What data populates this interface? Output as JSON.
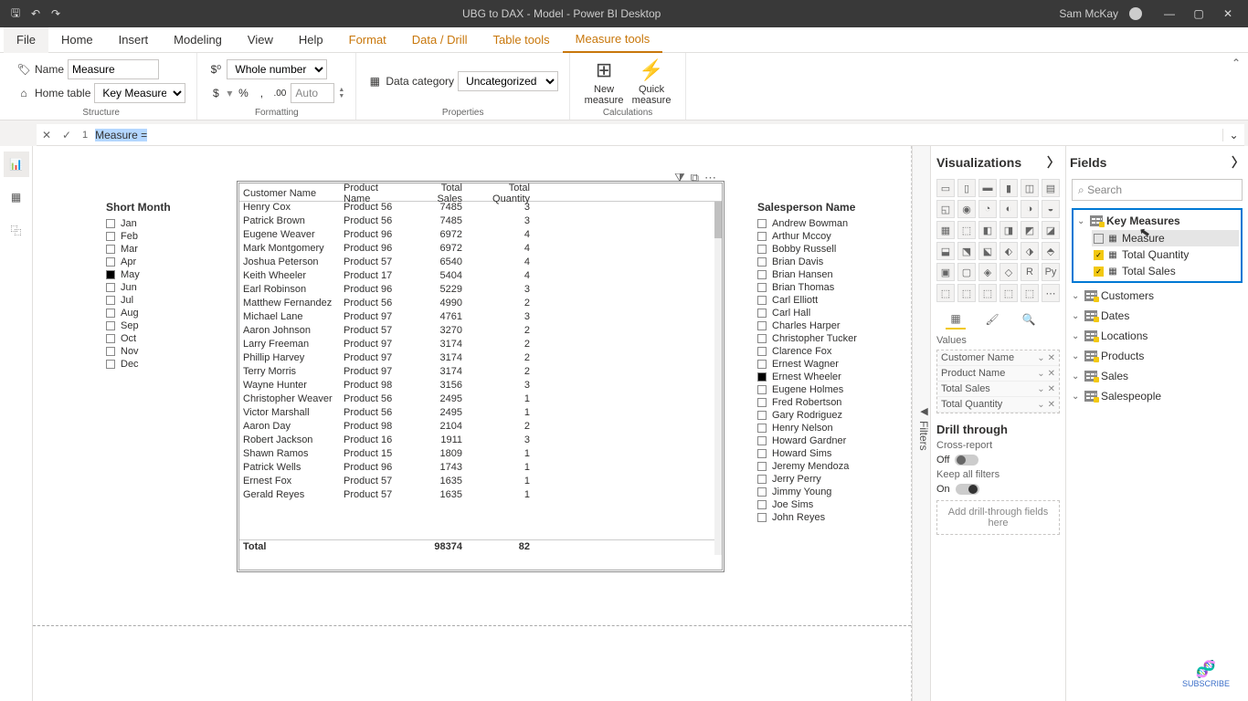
{
  "titlebar": {
    "title": "UBG to DAX - Model - Power BI Desktop",
    "user": "Sam McKay"
  },
  "tabs": {
    "file": "File",
    "home": "Home",
    "insert": "Insert",
    "modeling": "Modeling",
    "view": "View",
    "help": "Help",
    "format": "Format",
    "datadrill": "Data / Drill",
    "tabletools": "Table tools",
    "measuretools": "Measure tools"
  },
  "ribbon": {
    "name_label": "Name",
    "name_value": "Measure",
    "hometable_label": "Home table",
    "hometable_value": "Key Measures",
    "format_value": "Whole number",
    "auto_label": "Auto",
    "datacat_label": "Data category",
    "datacat_value": "Uncategorized",
    "newmeasure": "New measure",
    "quickmeasure": "Quick measure",
    "g_structure": "Structure",
    "g_formatting": "Formatting",
    "g_properties": "Properties",
    "g_calculations": "Calculations"
  },
  "formula": {
    "line": "1",
    "text_sel": "Measure =",
    "text_rest": ""
  },
  "slicer_month": {
    "title": "Short Month",
    "items": [
      "Jan",
      "Feb",
      "Mar",
      "Apr",
      "May",
      "Jun",
      "Jul",
      "Aug",
      "Sep",
      "Oct",
      "Nov",
      "Dec"
    ],
    "selected": "May"
  },
  "table": {
    "headers": {
      "c1": "Customer Name",
      "c2": "Product Name",
      "c3": "Total Sales",
      "c4": "Total Quantity"
    },
    "rows": [
      {
        "c": "Henry Cox",
        "p": "Product 56",
        "s": "7485",
        "q": "3"
      },
      {
        "c": "Patrick Brown",
        "p": "Product 56",
        "s": "7485",
        "q": "3"
      },
      {
        "c": "Eugene Weaver",
        "p": "Product 96",
        "s": "6972",
        "q": "4"
      },
      {
        "c": "Mark Montgomery",
        "p": "Product 96",
        "s": "6972",
        "q": "4"
      },
      {
        "c": "Joshua Peterson",
        "p": "Product 57",
        "s": "6540",
        "q": "4"
      },
      {
        "c": "Keith Wheeler",
        "p": "Product 17",
        "s": "5404",
        "q": "4"
      },
      {
        "c": "Earl Robinson",
        "p": "Product 96",
        "s": "5229",
        "q": "3"
      },
      {
        "c": "Matthew Fernandez",
        "p": "Product 56",
        "s": "4990",
        "q": "2"
      },
      {
        "c": "Michael Lane",
        "p": "Product 97",
        "s": "4761",
        "q": "3"
      },
      {
        "c": "Aaron Johnson",
        "p": "Product 57",
        "s": "3270",
        "q": "2"
      },
      {
        "c": "Larry Freeman",
        "p": "Product 97",
        "s": "3174",
        "q": "2"
      },
      {
        "c": "Phillip Harvey",
        "p": "Product 97",
        "s": "3174",
        "q": "2"
      },
      {
        "c": "Terry Morris",
        "p": "Product 97",
        "s": "3174",
        "q": "2"
      },
      {
        "c": "Wayne Hunter",
        "p": "Product 98",
        "s": "3156",
        "q": "3"
      },
      {
        "c": "Christopher Weaver",
        "p": "Product 56",
        "s": "2495",
        "q": "1"
      },
      {
        "c": "Victor Marshall",
        "p": "Product 56",
        "s": "2495",
        "q": "1"
      },
      {
        "c": "Aaron Day",
        "p": "Product 98",
        "s": "2104",
        "q": "2"
      },
      {
        "c": "Robert Jackson",
        "p": "Product 16",
        "s": "1911",
        "q": "3"
      },
      {
        "c": "Shawn Ramos",
        "p": "Product 15",
        "s": "1809",
        "q": "1"
      },
      {
        "c": "Patrick Wells",
        "p": "Product 96",
        "s": "1743",
        "q": "1"
      },
      {
        "c": "Ernest Fox",
        "p": "Product 57",
        "s": "1635",
        "q": "1"
      },
      {
        "c": "Gerald Reyes",
        "p": "Product 57",
        "s": "1635",
        "q": "1"
      }
    ],
    "footer": {
      "label": "Total",
      "s": "98374",
      "q": "82"
    }
  },
  "slicer_sales": {
    "title": "Salesperson Name",
    "items": [
      "Andrew Bowman",
      "Arthur Mccoy",
      "Bobby Russell",
      "Brian Davis",
      "Brian Hansen",
      "Brian Thomas",
      "Carl Elliott",
      "Carl Hall",
      "Charles Harper",
      "Christopher Tucker",
      "Clarence Fox",
      "Ernest Wagner",
      "Ernest Wheeler",
      "Eugene Holmes",
      "Fred Robertson",
      "Gary Rodriguez",
      "Henry Nelson",
      "Howard Gardner",
      "Howard Sims",
      "Jeremy Mendoza",
      "Jerry Perry",
      "Jimmy Young",
      "Joe Sims",
      "John Reyes"
    ],
    "selected": "Ernest Wheeler"
  },
  "filters_label": "Filters",
  "viz": {
    "header": "Visualizations",
    "values_label": "Values",
    "wells": [
      "Customer Name",
      "Product Name",
      "Total Sales",
      "Total Quantity"
    ],
    "drill_header": "Drill through",
    "cross_label": "Cross-report",
    "off": "Off",
    "keep_label": "Keep all filters",
    "on": "On",
    "drop_hint": "Add drill-through fields here"
  },
  "fields": {
    "header": "Fields",
    "search": "Search",
    "key_measures": "Key Measures",
    "km_items": [
      {
        "label": "Measure",
        "checked": false
      },
      {
        "label": "Total Quantity",
        "checked": true
      },
      {
        "label": "Total Sales",
        "checked": true
      }
    ],
    "tables": [
      "Customers",
      "Dates",
      "Locations",
      "Products",
      "Sales",
      "Salespeople"
    ]
  },
  "subscribe": "SUBSCRIBE"
}
